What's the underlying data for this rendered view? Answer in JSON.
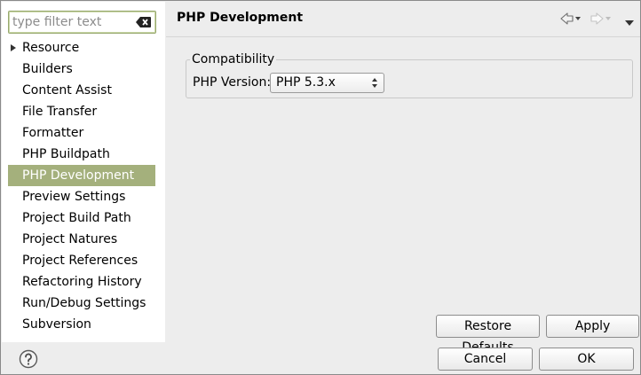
{
  "filter": {
    "placeholder": "type filter text",
    "clear_icon": "clear-filter-icon"
  },
  "tree": {
    "items": [
      {
        "label": "Resource",
        "expandable": true
      },
      {
        "label": "Builders"
      },
      {
        "label": "Content Assist"
      },
      {
        "label": "File Transfer"
      },
      {
        "label": "Formatter"
      },
      {
        "label": "PHP Buildpath"
      },
      {
        "label": "PHP Development",
        "selected": true
      },
      {
        "label": "Preview Settings"
      },
      {
        "label": "Project Build Path"
      },
      {
        "label": "Project Natures"
      },
      {
        "label": "Project References"
      },
      {
        "label": "Refactoring History"
      },
      {
        "label": "Run/Debug Settings"
      },
      {
        "label": "Subversion"
      }
    ],
    "selected_color": "#a4b07c"
  },
  "page": {
    "title": "PHP Development",
    "group_title": "Compatibility",
    "version_label": "PHP Version:",
    "version_value": "PHP 5.3.x"
  },
  "nav": {
    "back_icon": "back-arrow-icon",
    "forward_icon": "forward-arrow-icon",
    "menu_icon": "view-menu-icon"
  },
  "buttons": {
    "restore_defaults": "Restore Defaults",
    "apply": "Apply",
    "cancel": "Cancel",
    "ok": "OK"
  },
  "help_icon": "help-icon"
}
